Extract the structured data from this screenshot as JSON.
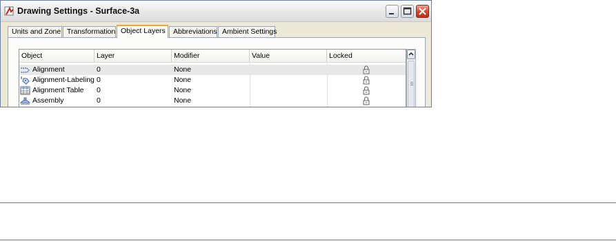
{
  "window": {
    "title": "Drawing Settings - Surface-3a"
  },
  "title_controls": {
    "minimize": "minimize",
    "maximize": "maximize",
    "close": "close"
  },
  "tabs": [
    {
      "label": "Units and Zone",
      "active": false
    },
    {
      "label": "Transformation",
      "active": false
    },
    {
      "label": "Object Layers",
      "active": true
    },
    {
      "label": "Abbreviations",
      "active": false
    },
    {
      "label": "Ambient Settings",
      "active": false
    }
  ],
  "table": {
    "columns": [
      "Object",
      "Layer",
      "Modifier",
      "Value",
      "Locked"
    ],
    "rows": [
      {
        "object": "Alignment",
        "icon": "alignment-icon",
        "layer": "0",
        "modifier": "None",
        "value": "",
        "locked": "lock-icon",
        "selected": true
      },
      {
        "object": "Alignment-Labeling",
        "icon": "alignment-labeling-icon",
        "layer": "0",
        "modifier": "None",
        "value": "",
        "locked": "lock-icon",
        "selected": false
      },
      {
        "object": "Alignment Table",
        "icon": "table-icon",
        "layer": "0",
        "modifier": "None",
        "value": "",
        "locked": "lock-icon",
        "selected": false
      },
      {
        "object": "Assembly",
        "icon": "assembly-icon",
        "layer": "0",
        "modifier": "None",
        "value": "",
        "locked": "lock-icon",
        "selected": false
      }
    ]
  },
  "colors": {
    "active_tab_accent": "#f3a43a",
    "close_button": "#d2452c",
    "selected_row": "#e8e8e8"
  }
}
